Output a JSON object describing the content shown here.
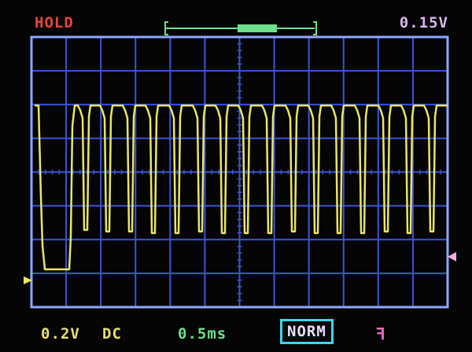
{
  "status": {
    "hold": "HOLD",
    "voltage_readout": "0.15V"
  },
  "bottom_bar": {
    "volts_per_div": "0.2V",
    "coupling": "DC",
    "time_per_div": "0.5ms",
    "trigger_mode": "NORM",
    "trigger_edge": "ꟻ"
  },
  "colors": {
    "trace": "#e9e664",
    "grid": "#3d55d8",
    "border": "#8fa8ff",
    "hold": "#e8453a",
    "voltage": "#d9b6f0",
    "timebase": "#6ee08c",
    "norm_border": "#3ad7f0",
    "edge": "#e870c8",
    "ch1_marker": "#e9e664",
    "trigger_marker": "#f0b0e0"
  },
  "icons": {
    "ch1_ground_marker": "triangle-right-icon",
    "trigger_level_marker": "triangle-left-icon",
    "buffer_position": "bracket-bar-icon",
    "trigger_edge": "rising-edge-icon"
  }
}
